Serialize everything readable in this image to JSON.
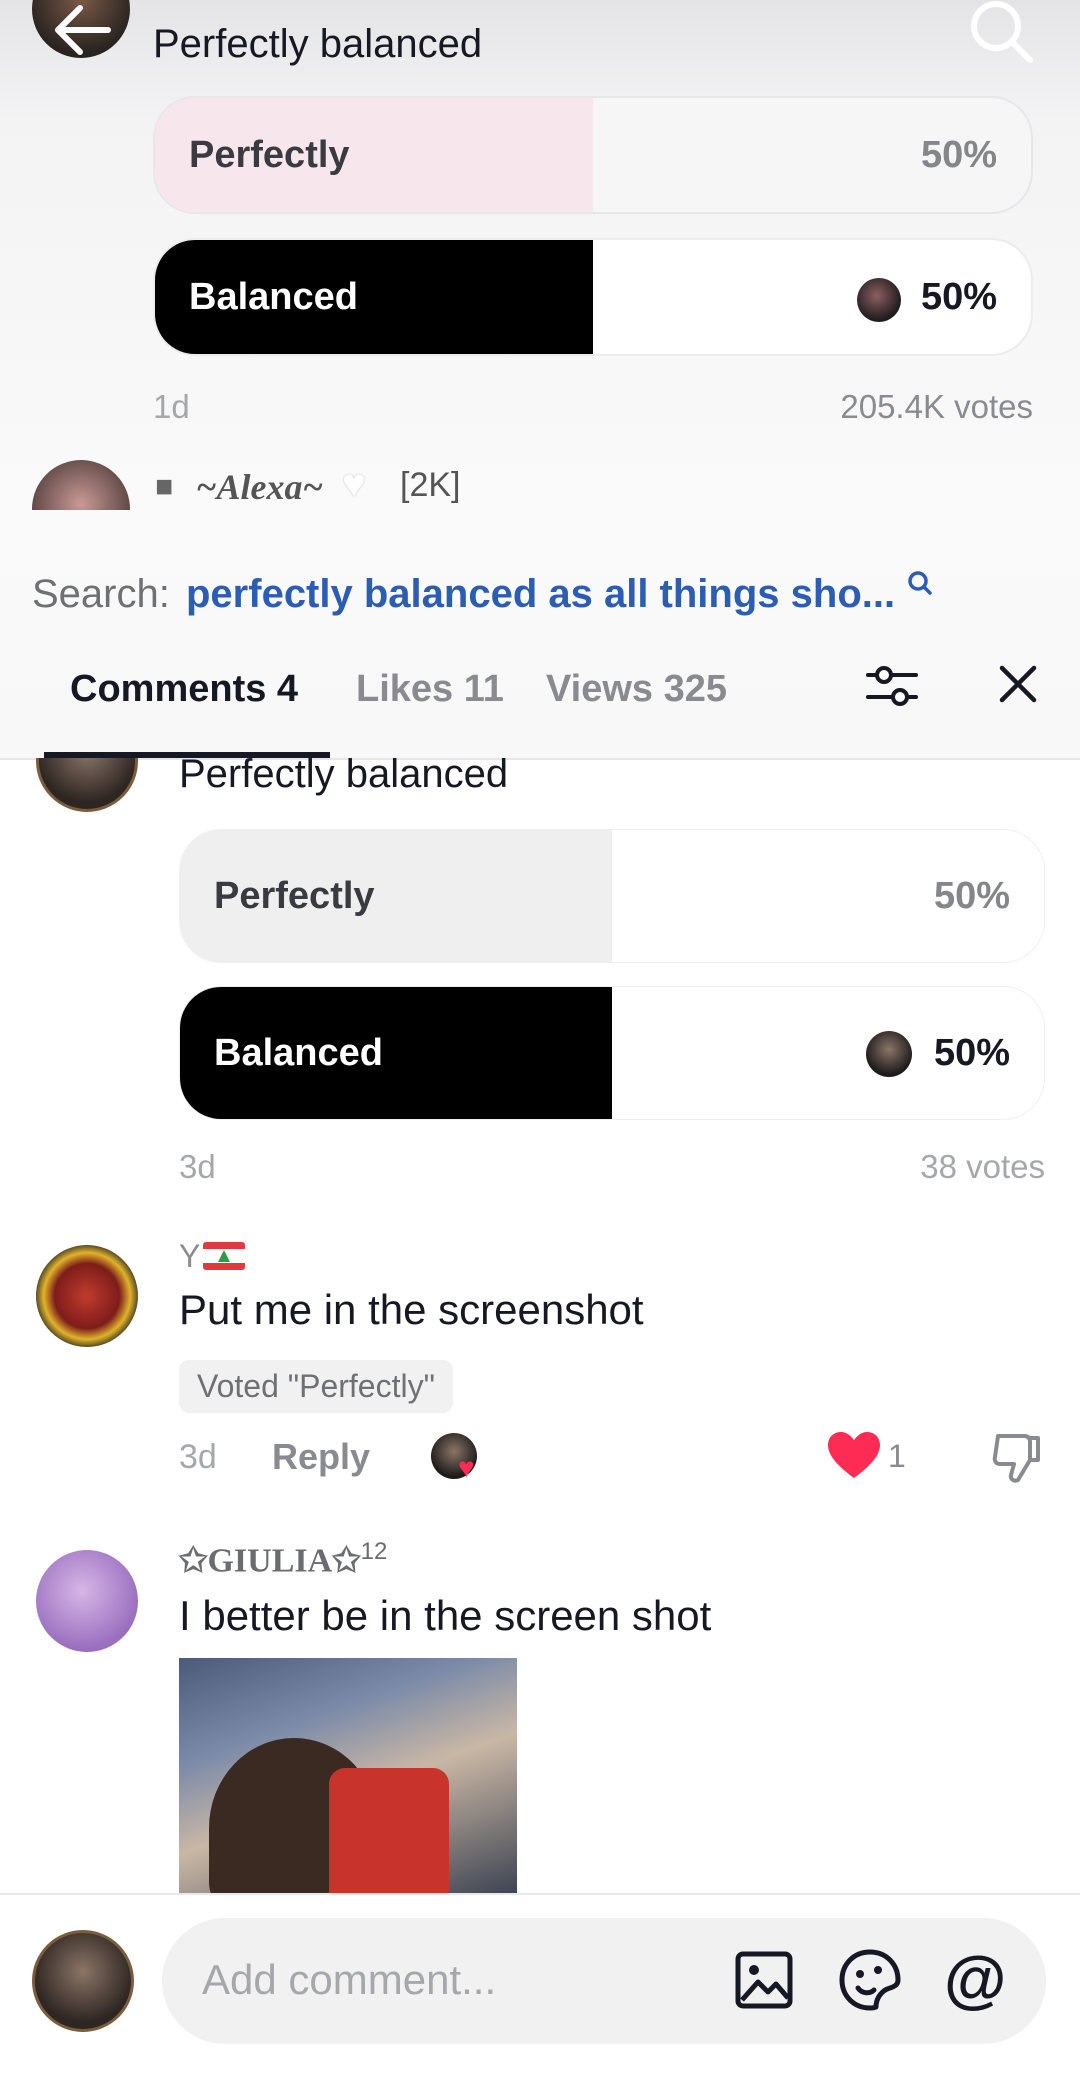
{
  "video_poll": {
    "question": "Perfectly balanced",
    "options": [
      {
        "label": "Perfectly",
        "percent_text": "50%",
        "fill_fraction": 0.5
      },
      {
        "label": "Balanced",
        "percent_text": "50%",
        "fill_fraction": 0.5
      }
    ],
    "age": "1d",
    "votes": "205.4K votes"
  },
  "next_user": {
    "name": "~Alexa~",
    "badge": "[2K]"
  },
  "search": {
    "prefix": "Search:",
    "query": "perfectly balanced as all things sho..."
  },
  "tabs": [
    {
      "label": "Comments 4",
      "active": true
    },
    {
      "label": "Likes 11",
      "active": false
    },
    {
      "label": "Views 325",
      "active": false
    }
  ],
  "sheet_poll": {
    "question": "Perfectly balanced",
    "options": [
      {
        "label": "Perfectly",
        "percent_text": "50%",
        "fill_fraction": 0.5
      },
      {
        "label": "Balanced",
        "percent_text": "50%",
        "fill_fraction": 0.5
      }
    ],
    "age": "3d",
    "votes": "38 votes"
  },
  "comments": [
    {
      "username": "Y",
      "text": "Put me in the screenshot",
      "voted_tag": "Voted \"Perfectly\"",
      "age": "3d",
      "reply_label": "Reply",
      "likes": "1"
    },
    {
      "username": "✩GIULIA✩",
      "username_sup": "12",
      "text": "I better be in the screen shot"
    }
  ],
  "composer": {
    "placeholder": "Add comment..."
  },
  "colors": {
    "accent_blue": "#2b5db5",
    "like_red": "#fe2c55",
    "poll_fill_light": "#eeeeef",
    "poll_fill_dark": "#000000"
  }
}
